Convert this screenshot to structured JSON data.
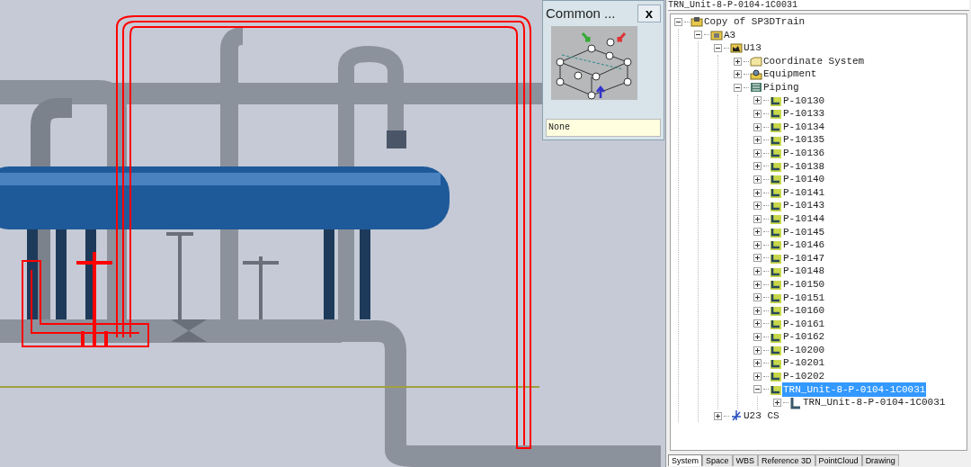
{
  "common_panel": {
    "title": "Common ...",
    "close": "x",
    "value": "None"
  },
  "workspace": {
    "filter": "TRN_Unit-8-P-0104-1C0031",
    "tree": [
      {
        "label": "Copy of SP3DTrain",
        "kind": "plant",
        "expanded": true,
        "selected": false,
        "children": [
          {
            "label": "A3",
            "kind": "area",
            "expanded": true,
            "selected": false,
            "children": [
              {
                "label": "U13",
                "kind": "unit",
                "expanded": true,
                "selected": false,
                "children": [
                  {
                    "label": "Coordinate System",
                    "kind": "folder",
                    "expanded": false,
                    "selected": false
                  },
                  {
                    "label": "Equipment",
                    "kind": "equipment",
                    "expanded": false,
                    "selected": false
                  },
                  {
                    "label": "Piping",
                    "kind": "piping",
                    "expanded": true,
                    "selected": false,
                    "children": [
                      {
                        "label": "P-10130",
                        "kind": "pipeline",
                        "expanded": false,
                        "selected": false
                      },
                      {
                        "label": "P-10133",
                        "kind": "pipeline",
                        "expanded": false,
                        "selected": false
                      },
                      {
                        "label": "P-10134",
                        "kind": "pipeline",
                        "expanded": false,
                        "selected": false
                      },
                      {
                        "label": "P-10135",
                        "kind": "pipeline",
                        "expanded": false,
                        "selected": false
                      },
                      {
                        "label": "P-10136",
                        "kind": "pipeline",
                        "expanded": false,
                        "selected": false
                      },
                      {
                        "label": "P-10138",
                        "kind": "pipeline",
                        "expanded": false,
                        "selected": false
                      },
                      {
                        "label": "P-10140",
                        "kind": "pipeline",
                        "expanded": false,
                        "selected": false
                      },
                      {
                        "label": "P-10141",
                        "kind": "pipeline",
                        "expanded": false,
                        "selected": false
                      },
                      {
                        "label": "P-10143",
                        "kind": "pipeline",
                        "expanded": false,
                        "selected": false
                      },
                      {
                        "label": "P-10144",
                        "kind": "pipeline",
                        "expanded": false,
                        "selected": false
                      },
                      {
                        "label": "P-10145",
                        "kind": "pipeline",
                        "expanded": false,
                        "selected": false
                      },
                      {
                        "label": "P-10146",
                        "kind": "pipeline",
                        "expanded": false,
                        "selected": false
                      },
                      {
                        "label": "P-10147",
                        "kind": "pipeline",
                        "expanded": false,
                        "selected": false
                      },
                      {
                        "label": "P-10148",
                        "kind": "pipeline",
                        "expanded": false,
                        "selected": false
                      },
                      {
                        "label": "P-10150",
                        "kind": "pipeline",
                        "expanded": false,
                        "selected": false
                      },
                      {
                        "label": "P-10151",
                        "kind": "pipeline",
                        "expanded": false,
                        "selected": false
                      },
                      {
                        "label": "P-10160",
                        "kind": "pipeline",
                        "expanded": false,
                        "selected": false
                      },
                      {
                        "label": "P-10161",
                        "kind": "pipeline",
                        "expanded": false,
                        "selected": false
                      },
                      {
                        "label": "P-10162",
                        "kind": "pipeline",
                        "expanded": false,
                        "selected": false
                      },
                      {
                        "label": "P-10200",
                        "kind": "pipeline",
                        "expanded": false,
                        "selected": false
                      },
                      {
                        "label": "P-10201",
                        "kind": "pipeline",
                        "expanded": false,
                        "selected": false
                      },
                      {
                        "label": "P-10202",
                        "kind": "pipeline",
                        "expanded": false,
                        "selected": false
                      },
                      {
                        "label": "TRN_Unit-8-P-0104-1C0031",
                        "kind": "pipeline",
                        "expanded": true,
                        "selected": true,
                        "children": [
                          {
                            "label": "TRN_Unit-8-P-0104-1C0031",
                            "kind": "piperun",
                            "expanded": false,
                            "selected": false
                          }
                        ]
                      }
                    ]
                  }
                ]
              },
              {
                "label": "U23 CS",
                "kind": "coordsys",
                "expanded": false,
                "selected": false
              }
            ]
          }
        ]
      }
    ],
    "tabs": [
      {
        "label": "System",
        "selected": true
      },
      {
        "label": "Space",
        "selected": false
      },
      {
        "label": "WBS",
        "selected": false
      },
      {
        "label": "Reference 3D",
        "selected": false
      },
      {
        "label": "PointCloud",
        "selected": false
      },
      {
        "label": "Drawing",
        "selected": false
      }
    ]
  }
}
